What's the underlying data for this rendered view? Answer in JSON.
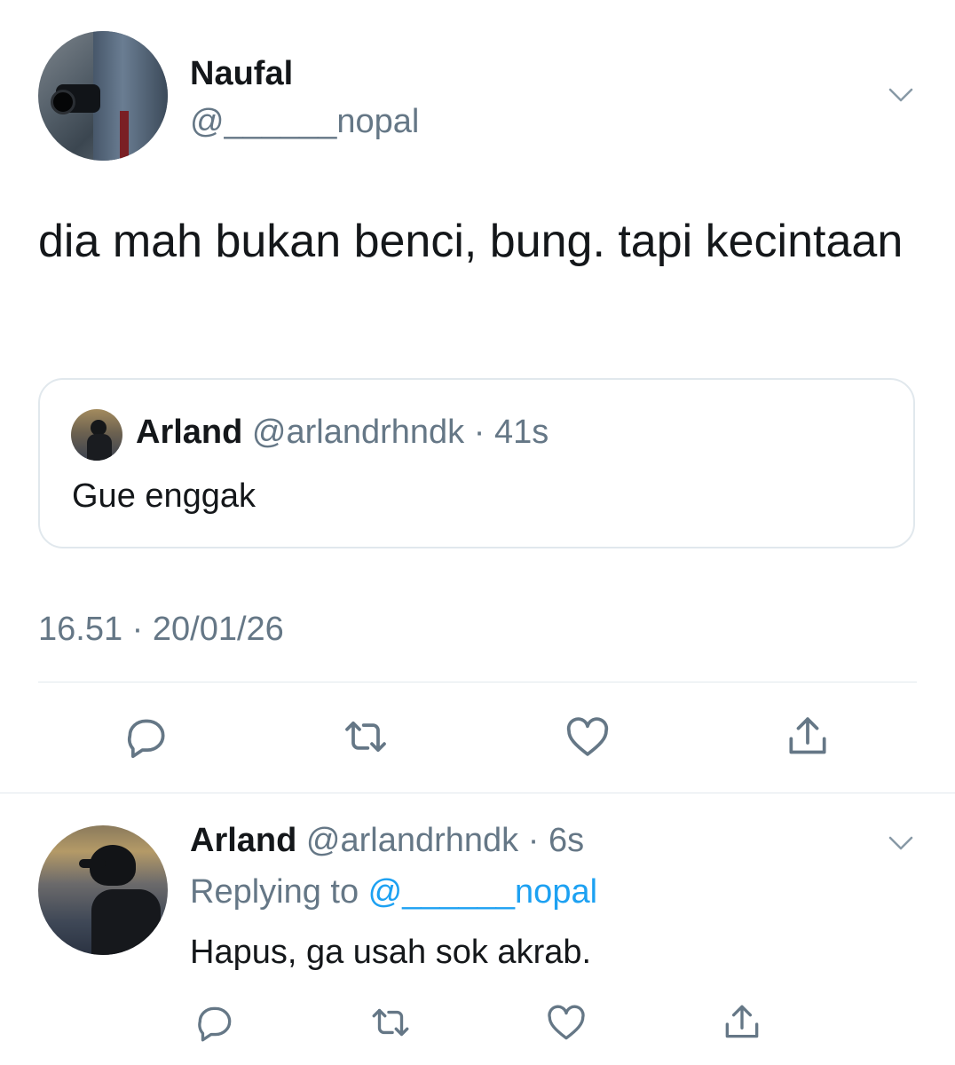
{
  "colors": {
    "text_primary": "#14171a",
    "text_secondary": "#657786",
    "link": "#1da1f2",
    "border": "#e1e8ed"
  },
  "main_tweet": {
    "author_name": "Naufal",
    "author_handle": "@______nopal",
    "text": "dia mah bukan benci, bung. tapi kecintaan",
    "timestamp": "16.51 · 20/01/26",
    "quote": {
      "author_name": "Arland",
      "author_handle": "@arlandrhndk",
      "separator": " · ",
      "time": "41s",
      "text": "Gue enggak"
    },
    "actions": [
      {
        "icon": "reply-icon"
      },
      {
        "icon": "retweet-icon"
      },
      {
        "icon": "like-icon"
      },
      {
        "icon": "share-icon"
      }
    ]
  },
  "reply": {
    "author_name": "Arland",
    "author_handle": "@arlandrhndk",
    "separator": " · ",
    "time": "6s",
    "replying_prefix": "Replying to ",
    "replying_to": "@______nopal",
    "text": "Hapus, ga usah sok akrab.",
    "actions": [
      {
        "icon": "reply-icon"
      },
      {
        "icon": "retweet-icon"
      },
      {
        "icon": "like-icon"
      },
      {
        "icon": "share-icon"
      }
    ]
  }
}
